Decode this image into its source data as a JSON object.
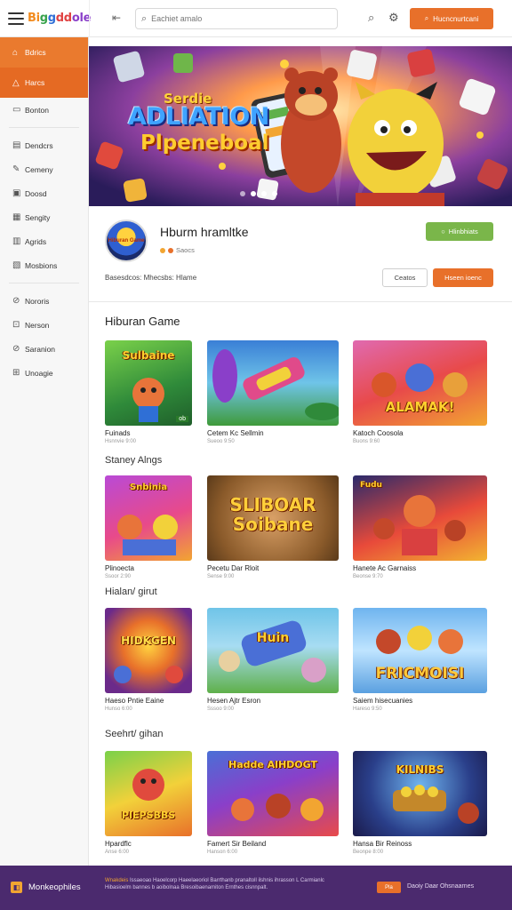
{
  "topbar": {
    "logo": [
      "Bi",
      "g",
      "g",
      "dd",
      "ole"
    ],
    "search_placeholder": "Eachiet amalo",
    "cta_label": "Hucncnurtcani"
  },
  "sidebar": {
    "items": [
      {
        "label": "Bdrics",
        "icon": "home-icon"
      },
      {
        "label": "Harcs",
        "icon": "flame-icon"
      },
      {
        "label": "Bonton",
        "icon": "book-icon"
      },
      {
        "label": "Dendcrs",
        "icon": "grid-icon"
      },
      {
        "label": "Cemeny",
        "icon": "pen-icon"
      },
      {
        "label": "Doosd",
        "icon": "doc-icon"
      },
      {
        "label": "Sengity",
        "icon": "chart-icon"
      },
      {
        "label": "Agrids",
        "icon": "list-icon"
      },
      {
        "label": "Mosbions",
        "icon": "box-icon"
      },
      {
        "label": "Nororis",
        "icon": "link-icon"
      },
      {
        "label": "Nerson",
        "icon": "user-icon"
      },
      {
        "label": "Saranion",
        "icon": "gear-icon"
      },
      {
        "label": "Unoagie",
        "icon": "cart-icon"
      }
    ]
  },
  "hero": {
    "line1": "Serdie",
    "line2": "ADLIATION",
    "line3": "Plpeneboal"
  },
  "profile": {
    "avatar_text": "Hiburan Game",
    "name": "Hburm hramltke",
    "meta": "Saocs",
    "desc": "Basesdcos: Mhecsbs: Hlame",
    "follow_label": "Hlinbhiats",
    "btn1_label": "Ceatos",
    "btn2_label": "Hseen ioenc"
  },
  "sections": [
    {
      "title": "Hiburan Game",
      "cards": [
        {
          "title": "Fuinads",
          "sub": "Hsnnvie 9:00",
          "art": "Sulbaine",
          "badge": "ob"
        },
        {
          "title": "Cetem Kc Sellmin",
          "sub": "Sueoo 9:50",
          "art": "",
          "badge": ""
        },
        {
          "title": "Katoch Coosola",
          "sub": "Buons 9:60",
          "art": "ALAMAK!",
          "badge": ""
        }
      ]
    },
    {
      "title": "Staney Alngs",
      "cards": [
        {
          "title": "Plinoecta",
          "sub": "Ssoor 2:90",
          "art": "Snbinia",
          "badge": ""
        },
        {
          "title": "Pecetu Dar Rloit",
          "sub": "Sense 9:00",
          "art": "SLIBOAR Soibane",
          "badge": ""
        },
        {
          "title": "Hanete Ac Garnaiss",
          "sub": "Beonse 9:70",
          "art": "Fudu",
          "badge": ""
        }
      ]
    },
    {
      "title": "Hialan/ girut",
      "cards": [
        {
          "title": "Haeso Pntie Eaine",
          "sub": "Hunso 6:00",
          "art": "HIDKGEN",
          "badge": ""
        },
        {
          "title": "Hesen Ajtr Esron",
          "sub": "Sssoo 9:00",
          "art": "Huin",
          "badge": ""
        },
        {
          "title": "Saiem hisecuanies",
          "sub": "Hareso 9:50",
          "art": "FRICMOISI",
          "badge": ""
        }
      ]
    },
    {
      "title": "Seehrt/ gihan",
      "cards": [
        {
          "title": "Hpardflc",
          "sub": "Anse 6:00",
          "art": "PIEPSBBS",
          "badge": ""
        },
        {
          "title": "Famert Sir Beiland",
          "sub": "Hanson 6:00",
          "art": "Hadde AlHDOGT",
          "badge": ""
        },
        {
          "title": "Hansa Bir Reinoss",
          "sub": "Beonpe 8:00",
          "art": "KILNIBS",
          "badge": ""
        }
      ]
    }
  ],
  "footer": {
    "brand": "Monkeophiles",
    "tag": "Wnakdeis",
    "text": "Issaeoao Haoelcorp Haeelaeoriol Barrthanb pranaltoll ilshnis ihrasson L Carmianlc Hibasioelm bannes b aoibolnaa Bresoibaenamiton Ernthes cisnnpalt.",
    "btn_label": "Pla",
    "link": "Daoiy Daar Ohsnaarnes"
  }
}
